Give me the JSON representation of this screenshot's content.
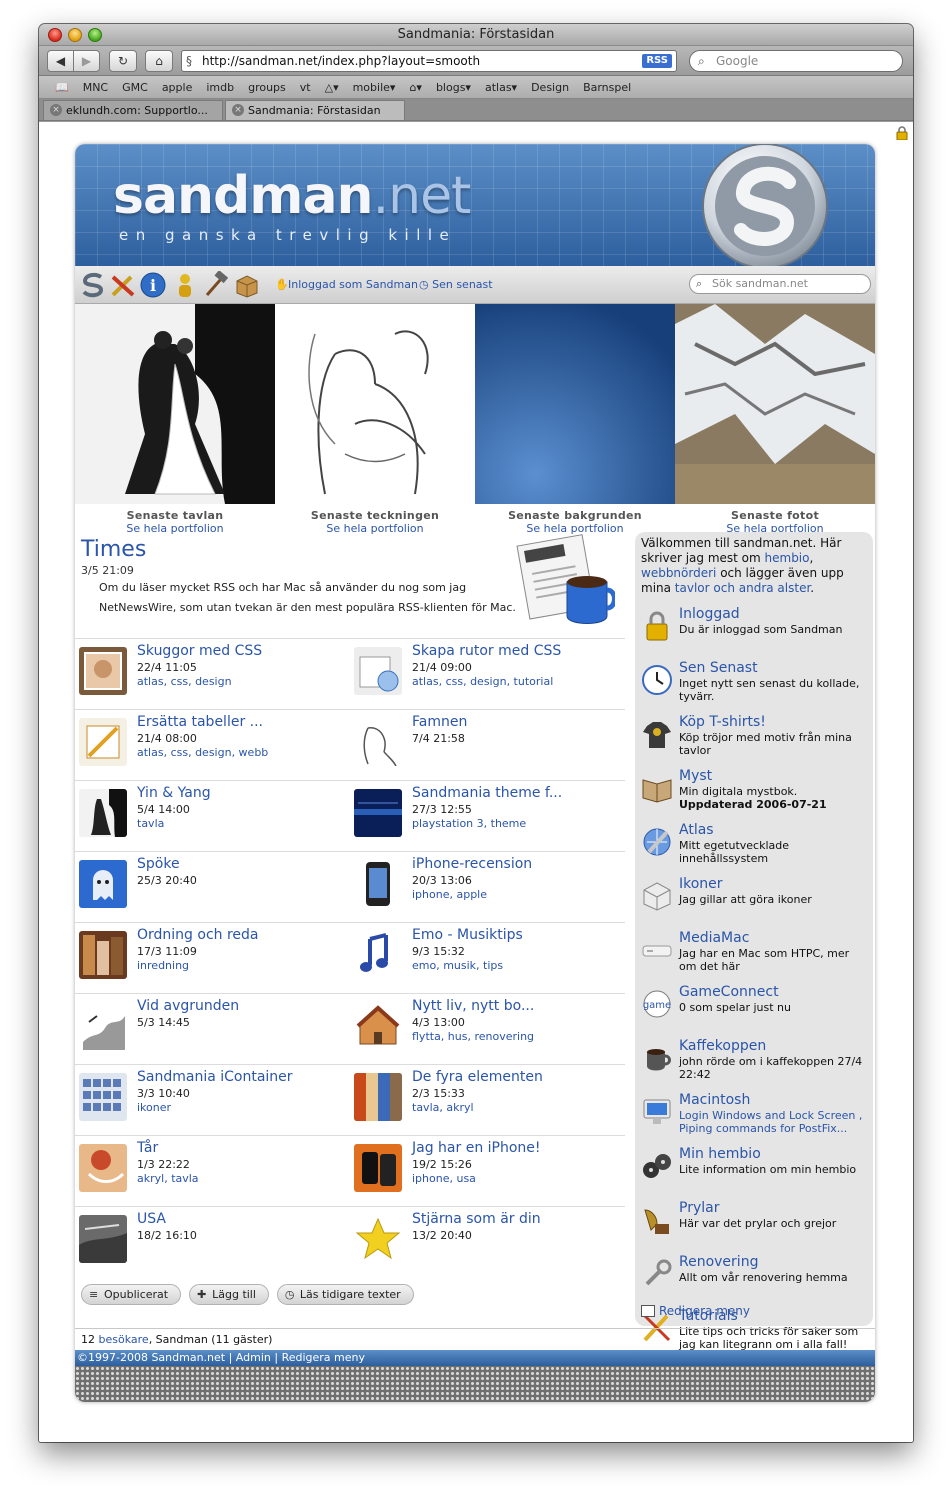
{
  "browser": {
    "title": "Sandmania: Förstasidan",
    "url": "http://sandman.net/index.php?layout=smooth",
    "rss": "RSS",
    "search_placeholder": "Google",
    "bookmarks": [
      "MNC",
      "GMC",
      "apple",
      "imdb",
      "groups",
      "vt",
      "△▾",
      "mobile▾",
      "⌂▾",
      "blogs▾",
      "atlas▾",
      "Design",
      "Barnspel"
    ],
    "tabs": [
      {
        "label": "eklundh.com: Supportlo...",
        "active": false
      },
      {
        "label": "Sandmania: Förstasidan",
        "active": true
      }
    ]
  },
  "site": {
    "logo_main": "sandman",
    "logo_dot": ".net",
    "tagline": "en ganska trevlig kille",
    "nav": {
      "logged_in": "Inloggad som Sandman",
      "latest": "Sen senast",
      "search_placeholder": "Sök sandman.net"
    },
    "portfolio": [
      {
        "caption": "Senaste tavlan",
        "link": "Se hela portfolion"
      },
      {
        "caption": "Senaste teckningen",
        "link": "Se hela portfolion"
      },
      {
        "caption": "Senaste bakgrunden",
        "link": "Se hela portfolion"
      },
      {
        "caption": "Senaste fotot",
        "link": "Se hela portfolion"
      }
    ],
    "times": {
      "title": "Times",
      "date": "3/5 21:09",
      "intro": "Om du läser mycket RSS och har Mac så använder du nog som jag NetNewsWire, som utan tvekan är den mest populära RSS-klienten för Mac."
    },
    "entries": [
      {
        "title": "Skuggor med CSS",
        "date": "22/4 11:05",
        "tags": "atlas, css, design"
      },
      {
        "title": "Skapa rutor med CSS",
        "date": "21/4 09:00",
        "tags": "atlas, css, design, tutorial"
      },
      {
        "title": "Ersätta tabeller ...",
        "date": "21/4 08:00",
        "tags": "atlas, css, design, webb"
      },
      {
        "title": "Famnen",
        "date": "7/4 21:58",
        "tags": ""
      },
      {
        "title": "Yin & Yang",
        "date": "5/4 14:00",
        "tags": "tavla"
      },
      {
        "title": "Sandmania theme f...",
        "date": "27/3 12:55",
        "tags": "playstation 3, theme"
      },
      {
        "title": "Spöke",
        "date": "25/3 20:40",
        "tags": ""
      },
      {
        "title": "iPhone-recension",
        "date": "20/3 13:06",
        "tags": "iphone, apple"
      },
      {
        "title": "Ordning och reda",
        "date": "17/3 11:09",
        "tags": "inredning"
      },
      {
        "title": "Emo - Musiktips",
        "date": "9/3 15:32",
        "tags": "emo, musik, tips"
      },
      {
        "title": "Vid avgrunden",
        "date": "5/3 14:45",
        "tags": ""
      },
      {
        "title": "Nytt liv, nytt bo...",
        "date": "4/3 13:00",
        "tags": "flytta, hus, renovering"
      },
      {
        "title": "Sandmania iContainer",
        "date": "3/3 10:40",
        "tags": "ikoner"
      },
      {
        "title": "De fyra elementen",
        "date": "2/3 15:33",
        "tags": "tavla, akryl"
      },
      {
        "title": "Tår",
        "date": "1/3 22:22",
        "tags": "akryl, tavla"
      },
      {
        "title": "Jag har en iPhone!",
        "date": "19/2 15:26",
        "tags": "iphone, usa"
      },
      {
        "title": "USA",
        "date": "18/2 16:10",
        "tags": ""
      },
      {
        "title": "Stjärna som är din",
        "date": "13/2 20:40",
        "tags": ""
      }
    ],
    "actions": [
      "Opublicerat",
      "Lägg till",
      "Läs tidigare texter"
    ],
    "sidebar": {
      "welcome_pre": "Välkommen till sandman.net. Här skriver jag mest om ",
      "welcome_link1": "hembio",
      "welcome_mid1": ", ",
      "welcome_link2": "webbnörderi",
      "welcome_mid2": " och lägger även upp mina ",
      "welcome_link3": "tavlor och andra alster",
      "welcome_end": ".",
      "items": [
        {
          "title": "Inloggad",
          "desc": "Du är inloggad som Sandman",
          "icon": "padlock-icon"
        },
        {
          "title": "Sen Senast",
          "desc": "Inget nytt sen senast du kollade, tyvärr.",
          "icon": "clock-icon"
        },
        {
          "title": "Köp T-shirts!",
          "desc": "Köp tröjor med motiv från mina tavlor",
          "icon": "tshirt-icon"
        },
        {
          "title": "Myst",
          "desc": "Min digitala mystbok. ",
          "desc_bold": "Uppdaterad 2006-07-21",
          "icon": "book-icon"
        },
        {
          "title": "Atlas",
          "desc": "Mitt egetutvecklade innehållssystem",
          "icon": "atlas-icon"
        },
        {
          "title": "Ikoner",
          "desc": "Jag gillar att göra ikoner",
          "icon": "cube-icon"
        },
        {
          "title": "MediaMac",
          "desc": "Jag har en Mac som HTPC, mer om det här",
          "icon": "macmini-icon"
        },
        {
          "title": "GameConnect",
          "desc": "0 som spelar just nu",
          "icon": "game-icon"
        },
        {
          "title": "Kaffekoppen",
          "desc": "john rörde om i kaffekoppen 27/4 22:42",
          "icon": "coffee-icon"
        },
        {
          "title": "Macintosh",
          "desc": "Login Windows and Lock Screen , Piping commands for PostFix...",
          "desc_link": true,
          "icon": "monitor-icon"
        },
        {
          "title": "Min hembio",
          "desc": "Lite information om min hembio",
          "icon": "film-icon"
        },
        {
          "title": "Prylar",
          "desc": "Här var det prylar och grejor",
          "icon": "gramophone-icon"
        },
        {
          "title": "Renovering",
          "desc": "Allt om vår renovering hemma",
          "icon": "wrench-icon"
        },
        {
          "title": "Tutorials",
          "desc": "Lite tips och tricks för saker som jag kan litegrann om i alla fall!",
          "icon": "tools-icon"
        }
      ],
      "edit": "Redigera meny"
    },
    "visitors": {
      "count": "12",
      "label": "besökare",
      "rest": ", Sandman (11 gäster)"
    },
    "footer": "©1997-2008 Sandman.net | Admin | Redigera meny"
  }
}
